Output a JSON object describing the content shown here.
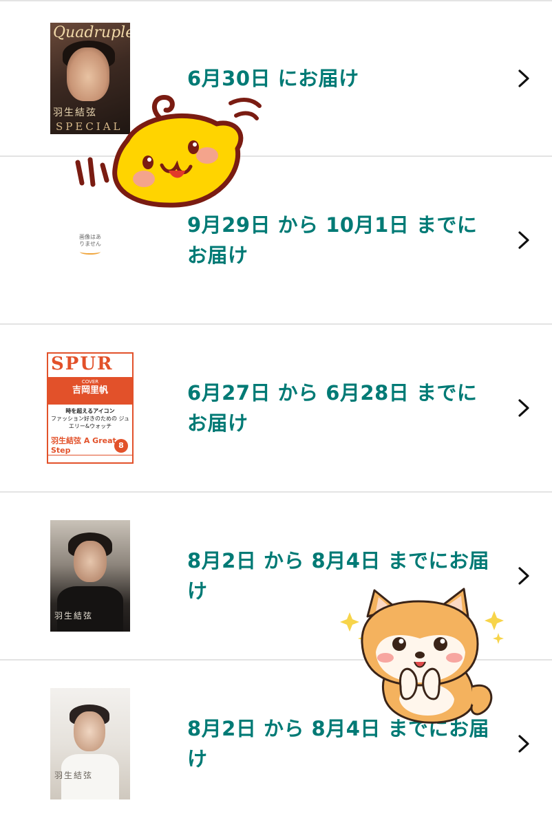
{
  "orders": [
    {
      "delivery": "6月30日 にお届け",
      "cover": "cover-quadruple"
    },
    {
      "delivery": "9月29日 から 10月1日 までにお届け",
      "cover": "cover-no-image",
      "placeholder": "画像はありません"
    },
    {
      "delivery": "6月27日 から 6月28日 までにお届け",
      "cover": "cover-spur"
    },
    {
      "delivery": "8月2日 から 8月4日 までにお届け",
      "cover": "cover-professional"
    },
    {
      "delivery": "8月2日 から 8月4日 までにお届け",
      "cover": "cover-professional-2"
    }
  ],
  "covers": {
    "quadruple": {
      "masthead": "Quadruple",
      "name": "羽生結弦",
      "special": "SPECIAL"
    },
    "spur": {
      "masthead": "SPUR",
      "cover_label": "COVER",
      "cover_name": "吉岡里帆",
      "cover_line": "時を超えるアイコン",
      "body": "ファッション好きのための ジュエリー&ウォッチ",
      "feature": "羽生結弦 A Great Step",
      "issue": "8"
    },
    "professional": {
      "title": "羽生結弦"
    }
  },
  "colors": {
    "accent": "#007a75",
    "divider": "#e3e3e3"
  },
  "icons": {
    "chevron": "chevron-right-icon"
  }
}
